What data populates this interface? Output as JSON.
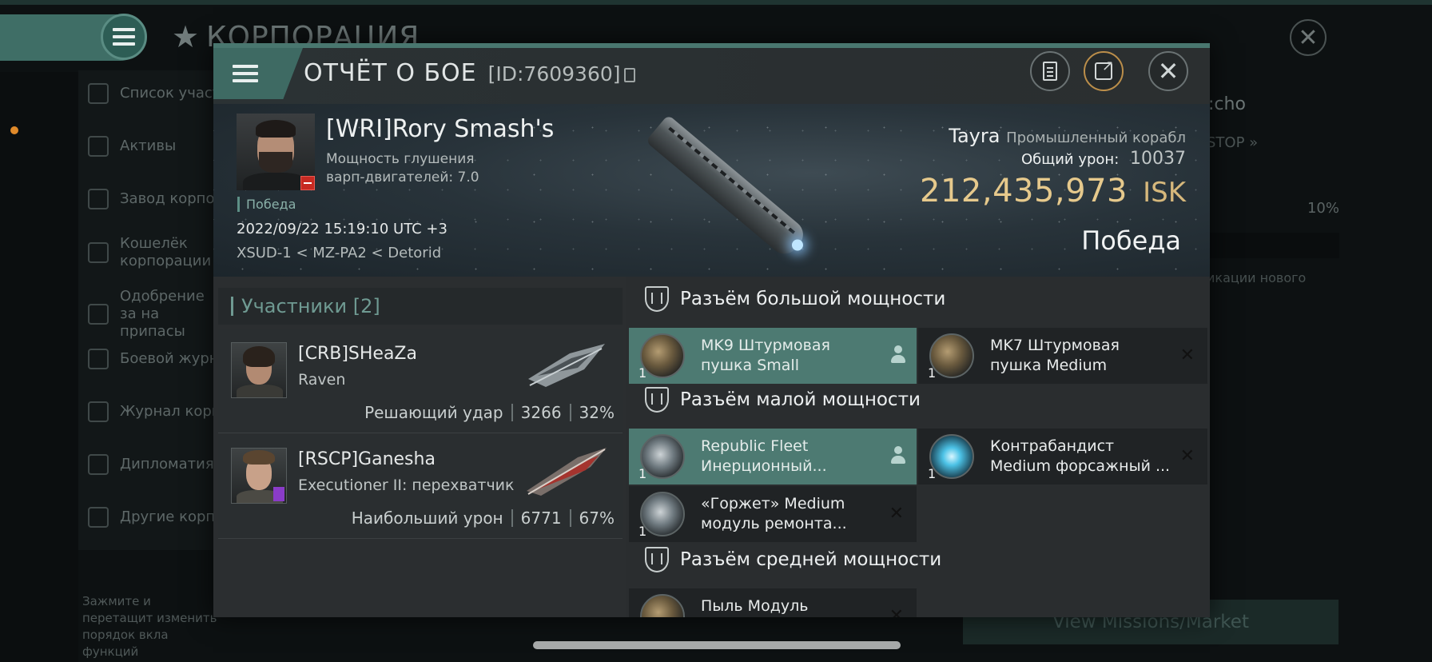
{
  "background": {
    "title": "КОРПОРАЦИЯ",
    "sidebar_items": [
      "Список участ",
      "Активы",
      "Завод корпор",
      "Кошелёк корпорации",
      "Одобрение за на припасы",
      "Боевой журна",
      "Журнал корпо",
      "Дипломатия",
      "Другие корпо"
    ],
    "sidebar_note": "Зажмите и перетащит изменить порядок вкла функций",
    "right_text": ":cho",
    "right_button": "STOP",
    "right_pct": "10%",
    "right_small": "икации нового",
    "missions_button": "View Missions/Market"
  },
  "dialog": {
    "title": "ОТЧЁТ О БОЕ",
    "id_label": "[ID:7609360]",
    "victim": {
      "name": "[WRI]Rory Smash's",
      "warp_label": "Мощность глушения",
      "warp_value": "варп-двигателей: 7.0",
      "tag": "Победа",
      "time": "2022/09/22 15:19:10 UTC +3",
      "location": "XSUD-1 < MZ-PA2 < Detorid"
    },
    "ship": {
      "name": "Tayra",
      "class": "Промышленный корабл",
      "damage_label": "Общий урон:",
      "damage_value": "10037",
      "isk_value": "212,435,973",
      "isk_unit": "ISK",
      "result": "Победа"
    },
    "participants": {
      "header": "Участники [2]",
      "items": [
        {
          "name": "[CRB]SHeaZa",
          "ship": "Raven",
          "stat_label": "Решающий удар",
          "damage": "3266",
          "percent": "32%"
        },
        {
          "name": "[RSCP]Ganesha",
          "ship": "Executioner II: перехватчик",
          "stat_label": "Наибольший урон",
          "damage": "6771",
          "percent": "67%"
        }
      ]
    },
    "slots": {
      "high": "Разъём большой мощности",
      "low": "Разъём малой мощности",
      "mid": "Разъём средней мощности"
    },
    "modules": [
      {
        "line1": "MK9 Штурмовая",
        "line2": "пушка Small",
        "qty": "1",
        "state": "active"
      },
      {
        "line1": "MK7 Штурмовая",
        "line2": "пушка Medium",
        "qty": "1",
        "state": "destroyed"
      },
      {
        "line1": "Republic Fleet",
        "line2": "Инерционный...",
        "qty": "1",
        "state": "active"
      },
      {
        "line1": "Контрабандист",
        "line2": "Medium форсажный ...",
        "qty": "1",
        "state": "destroyed"
      },
      {
        "line1": "«Горжет» Medium",
        "line2": "модуль ремонта...",
        "qty": "1",
        "state": "destroyed"
      },
      {
        "line1": "Пыль Модуль",
        "line2": "",
        "qty": "1",
        "state": "destroyed"
      }
    ],
    "destroyed_mark": "✕"
  },
  "colors": {
    "accent": "#4d7a72",
    "isk": "#e6c98c",
    "loss_badge": "#c72a22"
  },
  "icons": [
    "menu-icon",
    "star-icon",
    "close-icon",
    "report-icon",
    "share-icon",
    "copy-icon",
    "shield-icon",
    "person-icon"
  ]
}
